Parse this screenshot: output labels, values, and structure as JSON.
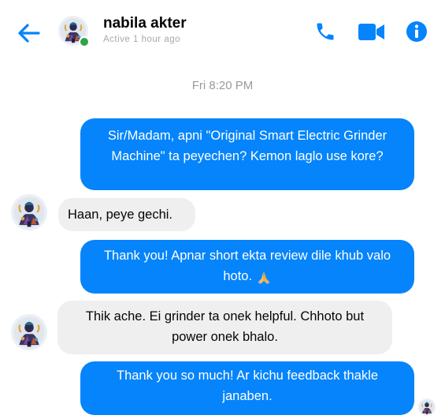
{
  "header": {
    "contact_name": "nabila akter",
    "status": "Active 1 hour ago",
    "icons": {
      "back": "back-arrow-icon",
      "call": "phone-icon",
      "video": "video-camera-icon",
      "info": "info-icon"
    },
    "accent_color": "#0584fb",
    "online_color": "#31a24c"
  },
  "conversation": {
    "timestamp": "Fri 8:20 PM",
    "messages": [
      {
        "direction": "outgoing",
        "text": "Sir/Madam, apni \"Original Smart Electric Grinder Machine\" ta peyechen? Kemon laglo use kore?"
      },
      {
        "direction": "incoming",
        "text": "Haan, peye gechi."
      },
      {
        "direction": "outgoing",
        "text": "Thank you! Apnar short ekta review dile khub valo hoto.",
        "emoji": "folded-hands-emoji"
      },
      {
        "direction": "incoming",
        "text": "Thik ache. Ei grinder ta onek helpful. Chhoto but power onek bhalo."
      },
      {
        "direction": "outgoing",
        "text": "Thank you so much! Ar kichu feedback thakle janaben."
      }
    ],
    "outgoing_color": "#0584fb",
    "incoming_color": "#efefef"
  }
}
